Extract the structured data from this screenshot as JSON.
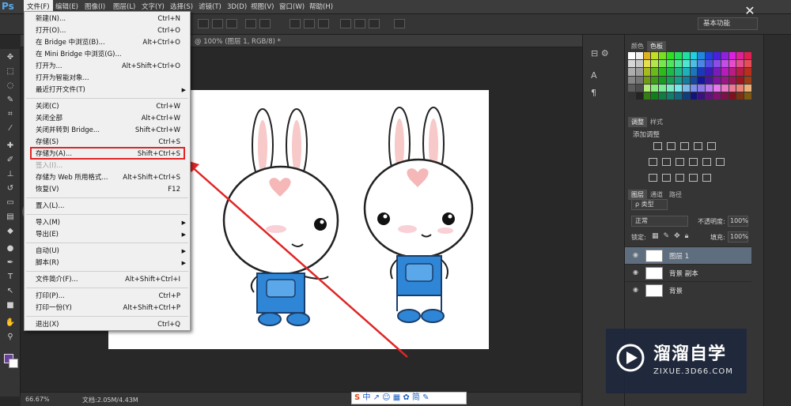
{
  "app": {
    "logo": "Ps",
    "workspace": "基本功能",
    "close_glyph": "✕"
  },
  "menubar": [
    "文件(F)",
    "编辑(E)",
    "图像(I)",
    "图层(L)",
    "文字(Y)",
    "选择(S)",
    "滤镜(T)",
    "3D(D)",
    "视图(V)",
    "窗口(W)",
    "帮助(H)"
  ],
  "document": {
    "tab_title": "@ 100% (图层 1, RGB/8) *",
    "zoom": "66.67%",
    "doc_size": "文档:2.05M/4.43M"
  },
  "file_menu": [
    {
      "label": "新建(N)...",
      "shortcut": "Ctrl+N"
    },
    {
      "label": "打开(O)...",
      "shortcut": "Ctrl+O"
    },
    {
      "label": "在 Bridge 中浏览(B)...",
      "shortcut": "Alt+Ctrl+O"
    },
    {
      "label": "在 Mini Bridge 中浏览(G)...",
      "shortcut": ""
    },
    {
      "label": "打开为...",
      "shortcut": "Alt+Shift+Ctrl+O"
    },
    {
      "label": "打开为智能对象...",
      "shortcut": ""
    },
    {
      "label": "最近打开文件(T)",
      "shortcut": "",
      "submenu": true
    },
    {
      "sep": true
    },
    {
      "label": "关闭(C)",
      "shortcut": "Ctrl+W"
    },
    {
      "label": "关闭全部",
      "shortcut": "Alt+Ctrl+W"
    },
    {
      "label": "关闭并转到 Bridge...",
      "shortcut": "Shift+Ctrl+W"
    },
    {
      "label": "存储(S)",
      "shortcut": "Ctrl+S"
    },
    {
      "label": "存储为(A)...",
      "shortcut": "Shift+Ctrl+S"
    },
    {
      "label": "签入(I)...",
      "shortcut": "",
      "disabled": true
    },
    {
      "label": "存储为 Web 所用格式...",
      "shortcut": "Alt+Shift+Ctrl+S"
    },
    {
      "label": "恢复(V)",
      "shortcut": "F12"
    },
    {
      "sep": true
    },
    {
      "label": "置入(L)...",
      "shortcut": ""
    },
    {
      "sep": true
    },
    {
      "label": "导入(M)",
      "shortcut": "",
      "submenu": true
    },
    {
      "label": "导出(E)",
      "shortcut": "",
      "submenu": true
    },
    {
      "sep": true
    },
    {
      "label": "自动(U)",
      "shortcut": "",
      "submenu": true
    },
    {
      "label": "脚本(R)",
      "shortcut": "",
      "submenu": true
    },
    {
      "sep": true
    },
    {
      "label": "文件简介(F)...",
      "shortcut": "Alt+Shift+Ctrl+I"
    },
    {
      "sep": true
    },
    {
      "label": "打印(P)...",
      "shortcut": "Ctrl+P"
    },
    {
      "label": "打印一份(Y)",
      "shortcut": "Alt+Shift+Ctrl+P"
    },
    {
      "sep": true
    },
    {
      "label": "退出(X)",
      "shortcut": "Ctrl+Q"
    }
  ],
  "panels": {
    "color_tabs": [
      "颜色",
      "色板"
    ],
    "adjust_tabs": [
      "调整",
      "样式"
    ],
    "adjust_label": "添加调整",
    "layer_tabs": [
      "图层",
      "通道",
      "路径"
    ],
    "filter": "ρ 类型",
    "blend_mode": "正常",
    "opacity_label": "不透明度:",
    "opacity": "100%",
    "lock_label": "锁定:",
    "fill_label": "填充:",
    "fill": "100%",
    "layers": [
      {
        "name": "图层 1",
        "selected": true
      },
      {
        "name": "背景 副本",
        "selected": false
      },
      {
        "name": "背景",
        "selected": false
      }
    ]
  },
  "ime": {
    "s": "S",
    "rest": "中 ↗ ☺ ▦ ✿ 简 ✎"
  },
  "watermark": {
    "title": "溜溜自学",
    "subtitle": "ZIXUE.3D66.COM"
  },
  "colors": {
    "highlight": "#e02626",
    "accent": "#5aa9e8"
  }
}
